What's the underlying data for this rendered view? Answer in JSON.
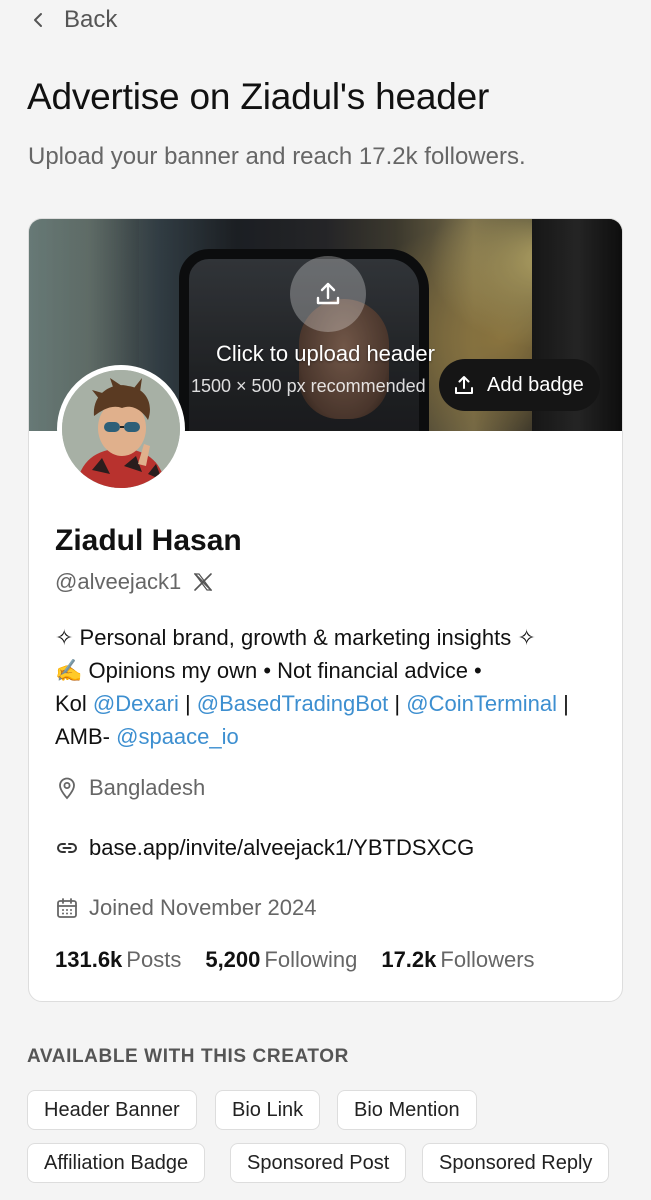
{
  "nav": {
    "back_label": "Back"
  },
  "header": {
    "title": "Advertise on Ziadul's header",
    "subtitle": "Upload your banner and reach 17.2k followers."
  },
  "banner": {
    "upload_label": "Click to upload header",
    "upload_hint": "1500 × 500 px recommended",
    "add_badge_label": "Add badge"
  },
  "profile": {
    "name": "Ziadul Hasan",
    "handle": "@alveejack1",
    "bio": {
      "line1": "✧ Personal brand, growth & marketing insights ✧",
      "line2": "✍️ Opinions my own  •  Not financial advice  •",
      "kol_prefix": "Kol ",
      "mention_dexari": "@Dexari",
      "sep": " | ",
      "mention_basedtradingbot": "@BasedTradingBot",
      "mention_cointerminal": "@CoinTerminal",
      "sep_end": " |",
      "amb_prefix": "AMB- ",
      "mention_spaace": "@spaace_io"
    },
    "location": "Bangladesh",
    "link": "base.app/invite/alveejack1/YBTDSXCG",
    "joined": "Joined November 2024",
    "stats": {
      "posts_value": "131.6k",
      "posts_label": "Posts",
      "following_value": "5,200",
      "following_label": "Following",
      "followers_value": "17.2k",
      "followers_label": "Followers"
    }
  },
  "available": {
    "title": "AVAILABLE WITH THIS CREATOR",
    "options": [
      "Header Banner",
      "Bio Link",
      "Bio Mention",
      "Affiliation Badge",
      "Sponsored Post",
      "Sponsored Reply"
    ]
  },
  "icons": {
    "back": "chevron-left-icon",
    "upload": "upload-icon",
    "platform": "x-logo-icon",
    "location": "map-pin-icon",
    "link": "link-icon",
    "calendar": "calendar-icon"
  },
  "colors": {
    "mention": "#3d8fd0",
    "badge_bg": "#151515",
    "page_bg": "#f4f4f4"
  }
}
